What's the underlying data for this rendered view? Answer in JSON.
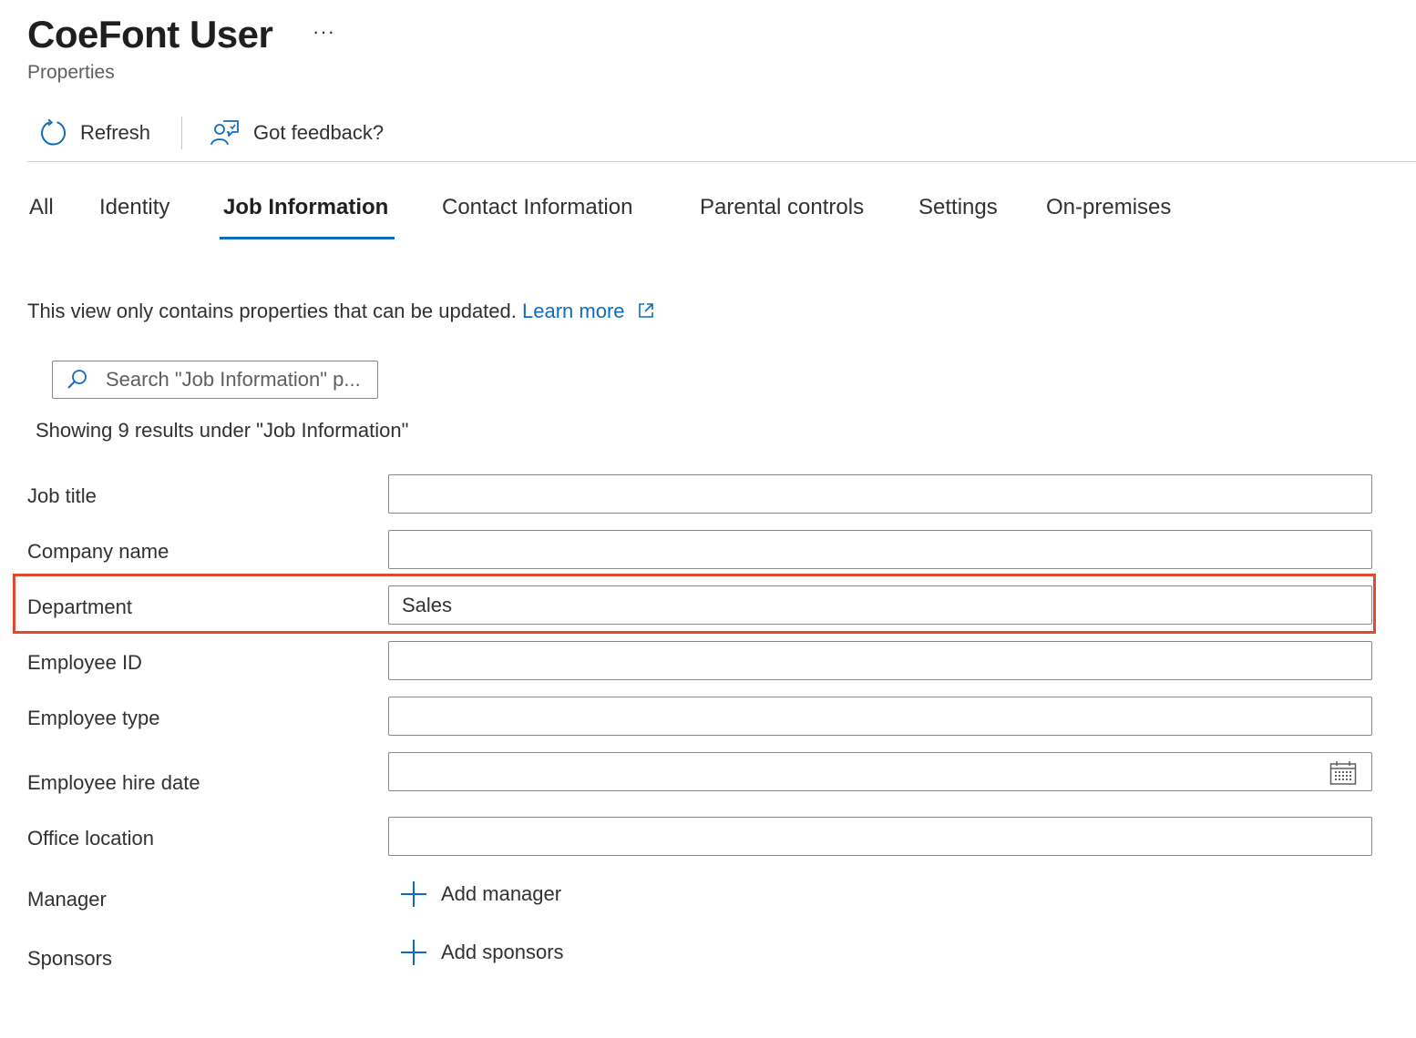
{
  "header": {
    "title": "CoeFont User",
    "more_label": "···",
    "subtitle": "Properties"
  },
  "toolbar": {
    "refresh_label": "Refresh",
    "feedback_label": "Got feedback?"
  },
  "tabs": [
    {
      "label": "All"
    },
    {
      "label": "Identity"
    },
    {
      "label": "Job Information",
      "active": true
    },
    {
      "label": "Contact Information"
    },
    {
      "label": "Parental controls"
    },
    {
      "label": "Settings"
    },
    {
      "label": "On-premises"
    }
  ],
  "info": {
    "text": "This view only contains properties that can be updated.",
    "link": "Learn more"
  },
  "search": {
    "placeholder": "Search \"Job Information\" p..."
  },
  "results_text": "Showing 9 results under \"Job Information\"",
  "fields": [
    {
      "label": "Job title",
      "value": ""
    },
    {
      "label": "Company name",
      "value": ""
    },
    {
      "label": "Department",
      "value": "Sales",
      "highlighted": true
    },
    {
      "label": "Employee ID",
      "value": ""
    },
    {
      "label": "Employee type",
      "value": ""
    },
    {
      "label": "Employee hire date",
      "value": ""
    },
    {
      "label": "Office location",
      "value": ""
    },
    {
      "label": "Manager",
      "action": "Add manager"
    },
    {
      "label": "Sponsors",
      "action": "Add sponsors"
    }
  ],
  "colors": {
    "accent": "#0f6cbd",
    "highlight_border": "#e04a2f",
    "text": "#323130"
  }
}
